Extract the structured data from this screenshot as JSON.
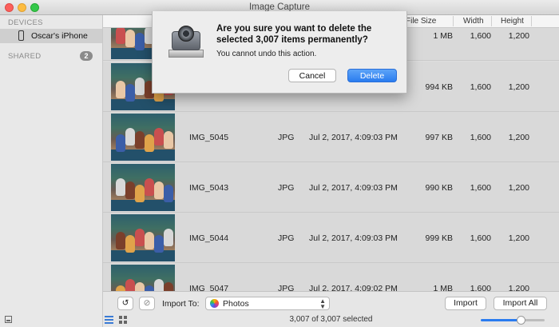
{
  "window": {
    "title": "Image Capture"
  },
  "sidebar": {
    "devices_header": "DEVICES",
    "device_name": "Oscar's iPhone",
    "shared_header": "SHARED",
    "shared_count": "2"
  },
  "columns": {
    "file_size": "File Size",
    "width": "Width",
    "height": "Height"
  },
  "rows": [
    {
      "name": "",
      "kind": "",
      "date": "",
      "size": "1 MB",
      "width": "1,600",
      "height": "1,200"
    },
    {
      "name": "",
      "kind": "",
      "date": "",
      "size": "994 KB",
      "width": "1,600",
      "height": "1,200"
    },
    {
      "name": "IMG_5045",
      "kind": "JPG",
      "date": "Jul 2, 2017, 4:09:03 PM",
      "size": "997 KB",
      "width": "1,600",
      "height": "1,200"
    },
    {
      "name": "IMG_5043",
      "kind": "JPG",
      "date": "Jul 2, 2017, 4:09:03 PM",
      "size": "990 KB",
      "width": "1,600",
      "height": "1,200"
    },
    {
      "name": "IMG_5044",
      "kind": "JPG",
      "date": "Jul 2, 2017, 4:09:03 PM",
      "size": "999 KB",
      "width": "1,600",
      "height": "1,200"
    },
    {
      "name": "IMG_5047",
      "kind": "JPG",
      "date": "Jul 2, 2017, 4:09:02 PM",
      "size": "1 MB",
      "width": "1,600",
      "height": "1,200"
    }
  ],
  "toolbar": {
    "import_to_label": "Import To:",
    "import_destination": "Photos",
    "import_button": "Import",
    "import_all_button": "Import All"
  },
  "status": {
    "selection_text": "3,007 of 3,007 selected",
    "thumbnail_size_fraction": 0.62
  },
  "dialog": {
    "title": "Are you sure you want to delete the selected 3,007 items permanently?",
    "message": "You cannot undo this action.",
    "cancel_button": "Cancel",
    "delete_button": "Delete"
  },
  "colors": {
    "accent": "#2a7cef",
    "selected_row": "#d9d9d9",
    "badge": "#8b8b8b"
  }
}
